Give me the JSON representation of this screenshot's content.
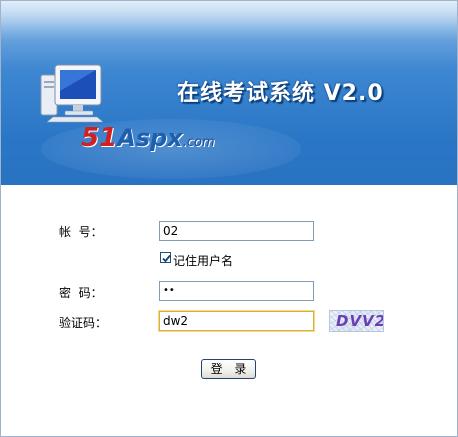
{
  "header": {
    "app_title": "在线考试系统 V2.0",
    "brand": {
      "part1": "51",
      "part2": "Aspx",
      "part3": ".com"
    },
    "icon": "computer-monitor-icon"
  },
  "form": {
    "account_label": "帐  号：",
    "account_value": "02",
    "remember_label": "记住用户名",
    "remember_checked": true,
    "password_label": "密  码：",
    "password_value": "••",
    "captcha_label": "验证码：",
    "captcha_value": "dw2",
    "captcha_image_text": "DVV2",
    "login_button": "登 录"
  },
  "colors": {
    "header_blue": "#2a76c6",
    "focus_border": "#d8b13c",
    "brand_red": "#d21f1f",
    "brand_blue": "#1f5fb0"
  }
}
